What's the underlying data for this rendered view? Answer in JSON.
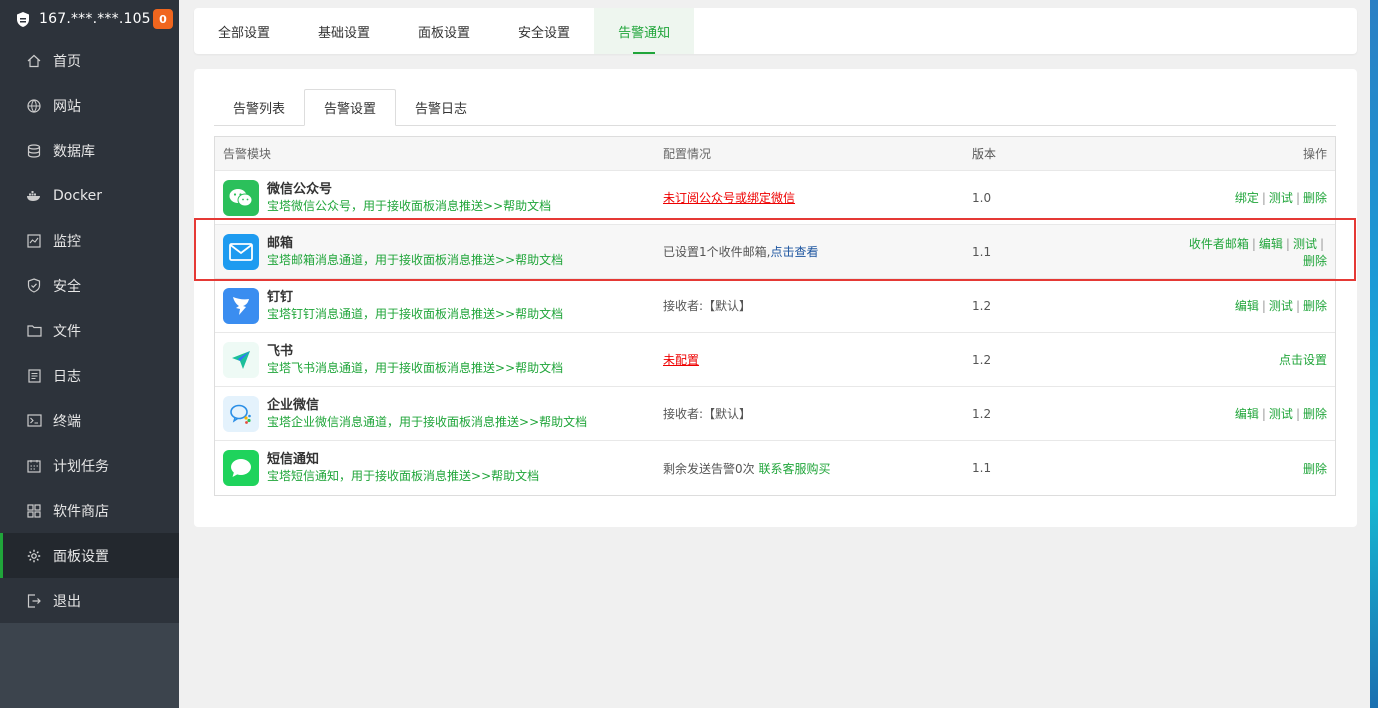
{
  "sidebar": {
    "ip": "167.***.***.105",
    "badge": "0",
    "items": [
      {
        "label": "首页",
        "icon": "home-icon"
      },
      {
        "label": "网站",
        "icon": "globe-icon"
      },
      {
        "label": "数据库",
        "icon": "database-icon"
      },
      {
        "label": "Docker",
        "icon": "docker-icon"
      },
      {
        "label": "监控",
        "icon": "monitor-icon"
      },
      {
        "label": "安全",
        "icon": "shield-icon"
      },
      {
        "label": "文件",
        "icon": "folder-icon"
      },
      {
        "label": "日志",
        "icon": "log-icon"
      },
      {
        "label": "终端",
        "icon": "terminal-icon"
      },
      {
        "label": "计划任务",
        "icon": "calendar-icon"
      },
      {
        "label": "软件商店",
        "icon": "grid-icon"
      },
      {
        "label": "面板设置",
        "icon": "gear-icon"
      },
      {
        "label": "退出",
        "icon": "logout-icon"
      }
    ],
    "active_index": 11
  },
  "top_tabs": [
    "全部设置",
    "基础设置",
    "面板设置",
    "安全设置",
    "告警通知"
  ],
  "top_tab_active": 4,
  "sub_tabs": [
    "告警列表",
    "告警设置",
    "告警日志"
  ],
  "sub_tab_active": 1,
  "table": {
    "headers": [
      "告警模块",
      "配置情况",
      "版本",
      "操作"
    ],
    "rows": [
      {
        "name": "微信公众号",
        "desc": "宝塔微信公众号，用于接收面板消息推送",
        "help": ">>帮助文档",
        "status": "未订阅公众号或绑定微信",
        "version": "1.0",
        "actions": [
          "绑定",
          "测试",
          "删除"
        ]
      },
      {
        "name": "邮箱",
        "desc": "宝塔邮箱消息通道，用于接收面板消息推送",
        "help": ">>帮助文档",
        "status_prefix": "已设置1个收件邮箱,",
        "status_link": "点击查看",
        "version": "1.1",
        "actions": [
          "收件者邮箱",
          "编辑",
          "测试",
          "删除"
        ]
      },
      {
        "name": "钉钉",
        "desc": "宝塔钉钉消息通道，用于接收面板消息推送",
        "help": ">>帮助文档",
        "status": "接收者:【默认】",
        "version": "1.2",
        "actions": [
          "编辑",
          "测试",
          "删除"
        ]
      },
      {
        "name": "飞书",
        "desc": "宝塔飞书消息通道，用于接收面板消息推送",
        "help": ">>帮助文档",
        "status": "未配置",
        "version": "1.2",
        "actions": [
          "点击设置"
        ]
      },
      {
        "name": "企业微信",
        "desc": "宝塔企业微信消息通道，用于接收面板消息推送",
        "help": ">>帮助文档",
        "status": "接收者:【默认】",
        "version": "1.2",
        "actions": [
          "编辑",
          "测试",
          "删除"
        ]
      },
      {
        "name": "短信通知",
        "desc": "宝塔短信通知，用于接收面板消息推送",
        "help": ">>帮助文档",
        "status_prefix": "剩余发送告警0次 ",
        "status_link": "联系客服购买",
        "version": "1.1",
        "actions": [
          "删除"
        ]
      }
    ]
  },
  "colors": {
    "accent": "#20a53a",
    "sidebar_bg": "#3c444d",
    "danger": "#e00000",
    "highlight_box": "#e53935"
  }
}
